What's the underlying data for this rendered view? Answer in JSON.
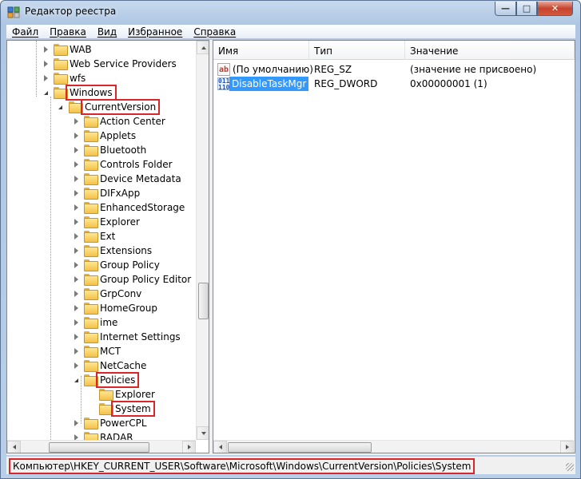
{
  "window": {
    "title": "Редактор реестра",
    "minimize_glyph": "—",
    "maximize_glyph": "□",
    "close_glyph": "✕"
  },
  "menu": [
    "Файл",
    "Правка",
    "Вид",
    "Избранное",
    "Справка"
  ],
  "tree": {
    "nodes": [
      {
        "label": "WAB",
        "state": "closed",
        "level": 0,
        "highlighted": false
      },
      {
        "label": "Web Service Providers",
        "state": "closed",
        "level": 0,
        "highlighted": false
      },
      {
        "label": "wfs",
        "state": "closed",
        "level": 0,
        "highlighted": false
      },
      {
        "label": "Windows",
        "state": "open",
        "level": 0,
        "highlighted": true
      },
      {
        "label": "CurrentVersion",
        "state": "open",
        "level": 1,
        "highlighted": true
      },
      {
        "label": "Action Center",
        "state": "closed",
        "level": 2,
        "highlighted": false
      },
      {
        "label": "Applets",
        "state": "closed",
        "level": 2,
        "highlighted": false
      },
      {
        "label": "Bluetooth",
        "state": "closed",
        "level": 2,
        "highlighted": false
      },
      {
        "label": "Controls Folder",
        "state": "closed",
        "level": 2,
        "highlighted": false
      },
      {
        "label": "Device Metadata",
        "state": "closed",
        "level": 2,
        "highlighted": false
      },
      {
        "label": "DIFxApp",
        "state": "closed",
        "level": 2,
        "highlighted": false
      },
      {
        "label": "EnhancedStorage",
        "state": "closed",
        "level": 2,
        "highlighted": false
      },
      {
        "label": "Explorer",
        "state": "closed",
        "level": 2,
        "highlighted": false
      },
      {
        "label": "Ext",
        "state": "closed",
        "level": 2,
        "highlighted": false
      },
      {
        "label": "Extensions",
        "state": "closed",
        "level": 2,
        "highlighted": false
      },
      {
        "label": "Group Policy",
        "state": "closed",
        "level": 2,
        "highlighted": false
      },
      {
        "label": "Group Policy Editor",
        "state": "closed",
        "level": 2,
        "highlighted": false
      },
      {
        "label": "GrpConv",
        "state": "closed",
        "level": 2,
        "highlighted": false
      },
      {
        "label": "HomeGroup",
        "state": "closed",
        "level": 2,
        "highlighted": false
      },
      {
        "label": "ime",
        "state": "closed",
        "level": 2,
        "highlighted": false
      },
      {
        "label": "Internet Settings",
        "state": "closed",
        "level": 2,
        "highlighted": false
      },
      {
        "label": "MCT",
        "state": "closed",
        "level": 2,
        "highlighted": false
      },
      {
        "label": "NetCache",
        "state": "closed",
        "level": 2,
        "highlighted": false
      },
      {
        "label": "Policies",
        "state": "open",
        "level": 2,
        "highlighted": true
      },
      {
        "label": "Explorer",
        "state": "none",
        "level": 3,
        "highlighted": false
      },
      {
        "label": "System",
        "state": "none",
        "level": 3,
        "highlighted": true
      },
      {
        "label": "PowerCPL",
        "state": "closed",
        "level": 2,
        "highlighted": false
      },
      {
        "label": "RADAR",
        "state": "closed",
        "level": 2,
        "highlighted": false
      }
    ]
  },
  "list": {
    "columns": [
      "Имя",
      "Тип",
      "Значение"
    ],
    "rows": [
      {
        "icon": "string-value-icon",
        "name": "(По умолчанию)",
        "type": "REG_SZ",
        "value": "(значение не присвоено)",
        "selected": false
      },
      {
        "icon": "binary-value-icon",
        "name": "DisableTaskMgr",
        "type": "REG_DWORD",
        "value": "0x00000001 (1)",
        "selected": true
      }
    ]
  },
  "status": {
    "path": "Компьютер\\HKEY_CURRENT_USER\\Software\\Microsoft\\Windows\\CurrentVersion\\Policies\\System"
  },
  "colors": {
    "highlight_border": "#d9262b",
    "selection": "#3399ff"
  }
}
